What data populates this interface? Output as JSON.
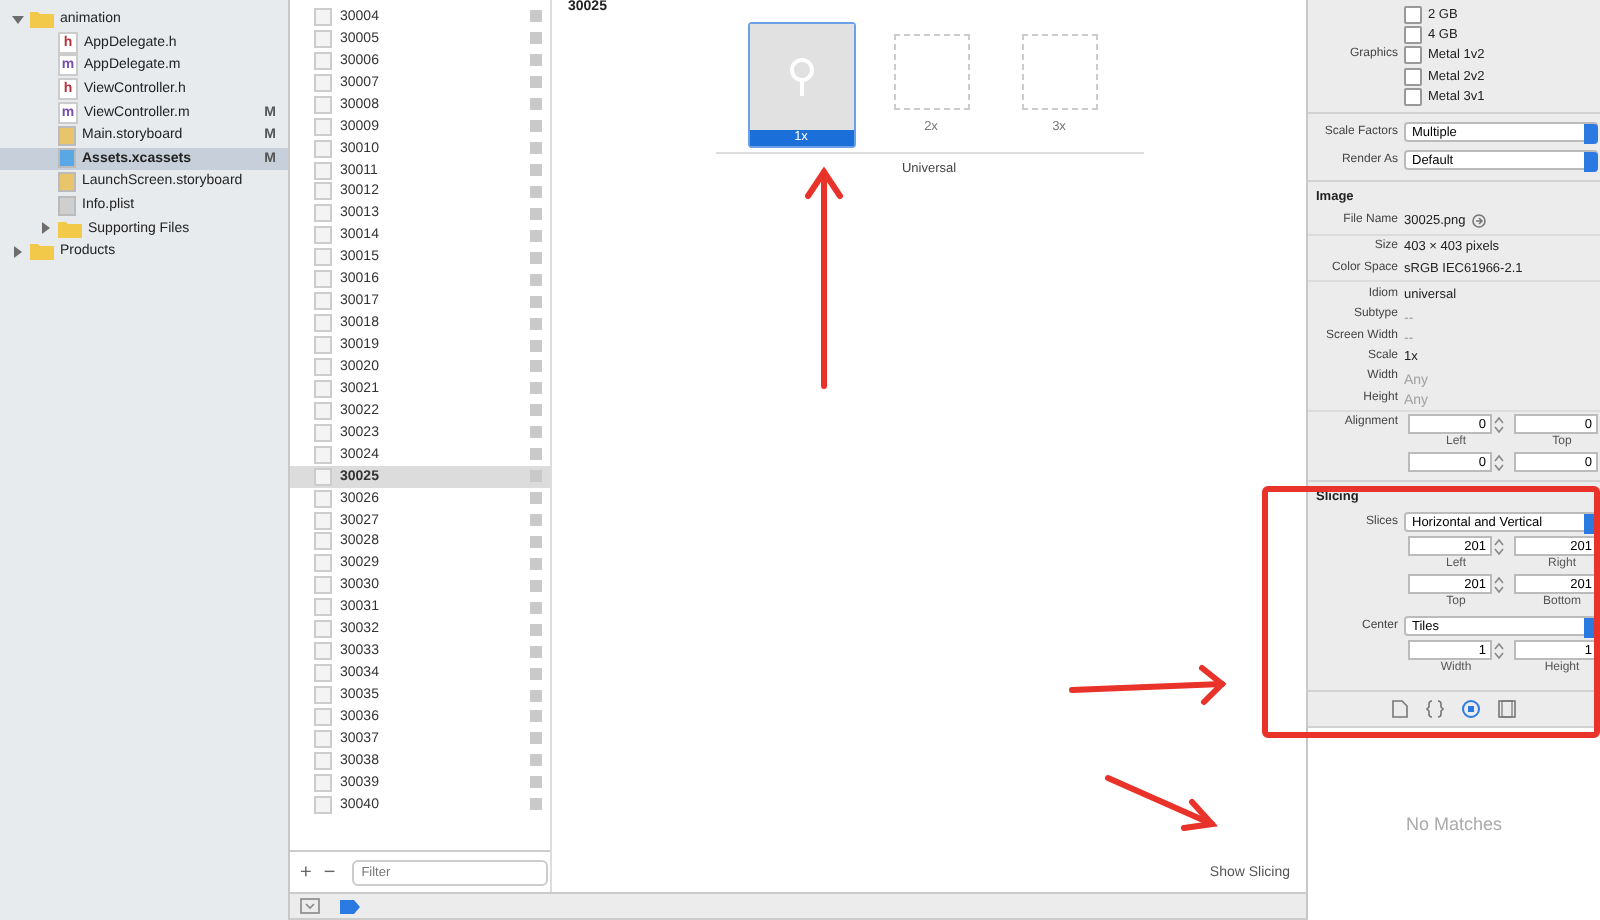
{
  "navigator": {
    "items": [
      {
        "name": "animation",
        "kind": "folder",
        "expanded": true,
        "selected": false,
        "children": [
          {
            "name": "AppDelegate.h",
            "kind": "header",
            "glyph": "h",
            "selected": false
          },
          {
            "name": "AppDelegate.m",
            "kind": "source",
            "glyph": "m",
            "selected": false
          },
          {
            "name": "ViewController.h",
            "kind": "header",
            "glyph": "h",
            "selected": false
          },
          {
            "name": "ViewController.m",
            "kind": "source",
            "glyph": "m",
            "badge": "M",
            "selected": false
          },
          {
            "name": "Main.storyboard",
            "kind": "storyboard",
            "badge": "M",
            "selected": false
          },
          {
            "name": "Assets.xcassets",
            "kind": "assets",
            "badge": "M",
            "selected": true
          },
          {
            "name": "LaunchScreen.storyboard",
            "kind": "storyboard",
            "selected": false
          },
          {
            "name": "Info.plist",
            "kind": "plist",
            "selected": false
          },
          {
            "name": "Supporting Files",
            "kind": "folder",
            "expanded": false,
            "selected": false
          }
        ]
      },
      {
        "name": "Products",
        "kind": "folder",
        "expanded": false,
        "selected": false
      }
    ]
  },
  "asset_list": {
    "items": [
      {
        "name": "30004",
        "selected": false
      },
      {
        "name": "30005",
        "selected": false
      },
      {
        "name": "30006",
        "selected": false
      },
      {
        "name": "30007",
        "selected": false
      },
      {
        "name": "30008",
        "selected": false
      },
      {
        "name": "30009",
        "selected": false
      },
      {
        "name": "30010",
        "selected": false
      },
      {
        "name": "30011",
        "selected": false
      },
      {
        "name": "30012",
        "selected": false
      },
      {
        "name": "30013",
        "selected": false
      },
      {
        "name": "30014",
        "selected": false
      },
      {
        "name": "30015",
        "selected": false
      },
      {
        "name": "30016",
        "selected": false
      },
      {
        "name": "30017",
        "selected": false
      },
      {
        "name": "30018",
        "selected": false
      },
      {
        "name": "30019",
        "selected": false
      },
      {
        "name": "30020",
        "selected": false
      },
      {
        "name": "30021",
        "selected": false
      },
      {
        "name": "30022",
        "selected": false
      },
      {
        "name": "30023",
        "selected": false
      },
      {
        "name": "30024",
        "selected": false
      },
      {
        "name": "30025",
        "selected": true
      },
      {
        "name": "30026",
        "selected": false
      },
      {
        "name": "30027",
        "selected": false
      },
      {
        "name": "30028",
        "selected": false
      },
      {
        "name": "30029",
        "selected": false
      },
      {
        "name": "30030",
        "selected": false
      },
      {
        "name": "30031",
        "selected": false
      },
      {
        "name": "30032",
        "selected": false
      },
      {
        "name": "30033",
        "selected": false
      },
      {
        "name": "30034",
        "selected": false
      },
      {
        "name": "30035",
        "selected": false
      },
      {
        "name": "30036",
        "selected": false
      },
      {
        "name": "30037",
        "selected": false
      },
      {
        "name": "30038",
        "selected": false
      },
      {
        "name": "30039",
        "selected": false
      },
      {
        "name": "30040",
        "selected": false
      }
    ],
    "add_button": "+",
    "remove_button": "−",
    "filter": {
      "placeholder": "Filter"
    }
  },
  "canvas": {
    "title": "30025",
    "slots": [
      {
        "label": "1x",
        "selected": true,
        "filled": true
      },
      {
        "label": "2x",
        "selected": false,
        "filled": false
      },
      {
        "label": "3x",
        "selected": false,
        "filled": false
      }
    ],
    "group_label": "Universal",
    "show_slicing": "Show Slicing"
  },
  "inspector": {
    "checkboxes": [
      {
        "label": "2 GB",
        "checked": false
      },
      {
        "label": "4 GB",
        "checked": false
      },
      {
        "group": "Graphics",
        "label": "Metal 1v2",
        "checked": false
      },
      {
        "label": "Metal 2v2",
        "checked": false
      },
      {
        "label": "Metal 3v1",
        "checked": false
      }
    ],
    "popups": [
      {
        "label": "Scale Factors",
        "value": "Multiple"
      },
      {
        "label": "Render As",
        "value": "Default"
      }
    ],
    "image": {
      "title": "Image",
      "groups": [
        [
          {
            "label": "File Name",
            "value": "30025.png",
            "muted": false,
            "reveal": true
          }
        ],
        [
          {
            "label": "Size",
            "value": "403 × 403 pixels",
            "muted": false
          },
          {
            "label": "Color Space",
            "value": "sRGB IEC61966-2.1",
            "muted": false
          }
        ],
        [
          {
            "label": "Idiom",
            "value": "universal",
            "muted": false
          },
          {
            "label": "Subtype",
            "value": "--",
            "muted": true
          },
          {
            "label": "Screen Width",
            "value": "--",
            "muted": true
          },
          {
            "label": "Scale",
            "value": "1x",
            "muted": false
          },
          {
            "label": "Width",
            "value": "Any",
            "muted": true
          },
          {
            "label": "Height",
            "value": "Any",
            "muted": true
          }
        ]
      ],
      "alignment": {
        "label": "Alignment",
        "rows": [
          [
            {
              "value": "0",
              "caption": "Left"
            },
            {
              "value": "0",
              "caption": "Top"
            }
          ],
          [
            {
              "value": "0"
            },
            {
              "value": "0"
            }
          ]
        ]
      }
    },
    "slicing": {
      "title": "Slicing",
      "slices": {
        "label": "Slices",
        "value": "Horizontal and Vertical"
      },
      "insets": [
        [
          {
            "value": "201",
            "caption": "Left"
          },
          {
            "value": "201",
            "caption": "Right"
          }
        ],
        [
          {
            "value": "201",
            "caption": "Top"
          },
          {
            "value": "201",
            "caption": "Bottom"
          }
        ]
      ],
      "center": {
        "label": "Center",
        "value": "Tiles"
      },
      "size": [
        {
          "value": "1",
          "caption": "Width"
        },
        {
          "value": "1",
          "caption": "Height"
        }
      ]
    },
    "tabs": [
      {
        "kind": "file",
        "selected": false
      },
      {
        "kind": "braces",
        "selected": false
      },
      {
        "kind": "circle",
        "selected": true
      },
      {
        "kind": "media",
        "selected": false
      }
    ],
    "library": {
      "empty_text": "No Matches"
    }
  }
}
